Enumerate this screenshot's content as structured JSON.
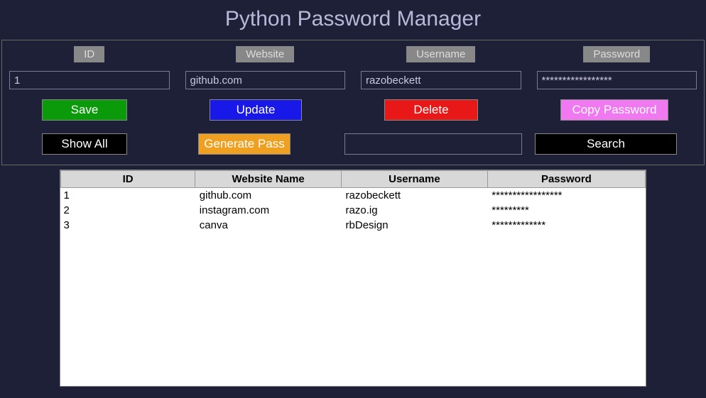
{
  "title": "Python Password Manager",
  "labels": {
    "id": "ID",
    "website": "Website",
    "username": "Username",
    "password": "Password"
  },
  "inputs": {
    "id": "1",
    "website": "github.com",
    "username": "razobeckett",
    "password": "*****************",
    "search": ""
  },
  "buttons": {
    "save": "Save",
    "update": "Update",
    "delete": "Delete",
    "copy": "Copy Password",
    "showall": "Show All",
    "generate": "Generate Pass",
    "search": "Search"
  },
  "table": {
    "headers": [
      "ID",
      "Website Name",
      "Username",
      "Password"
    ],
    "rows": [
      [
        "1",
        "github.com",
        "razobeckett",
        "*****************"
      ],
      [
        "2",
        "instagram.com",
        "razo.ig",
        "*********"
      ],
      [
        "3",
        "canva",
        "rbDesign",
        "*************"
      ]
    ]
  }
}
